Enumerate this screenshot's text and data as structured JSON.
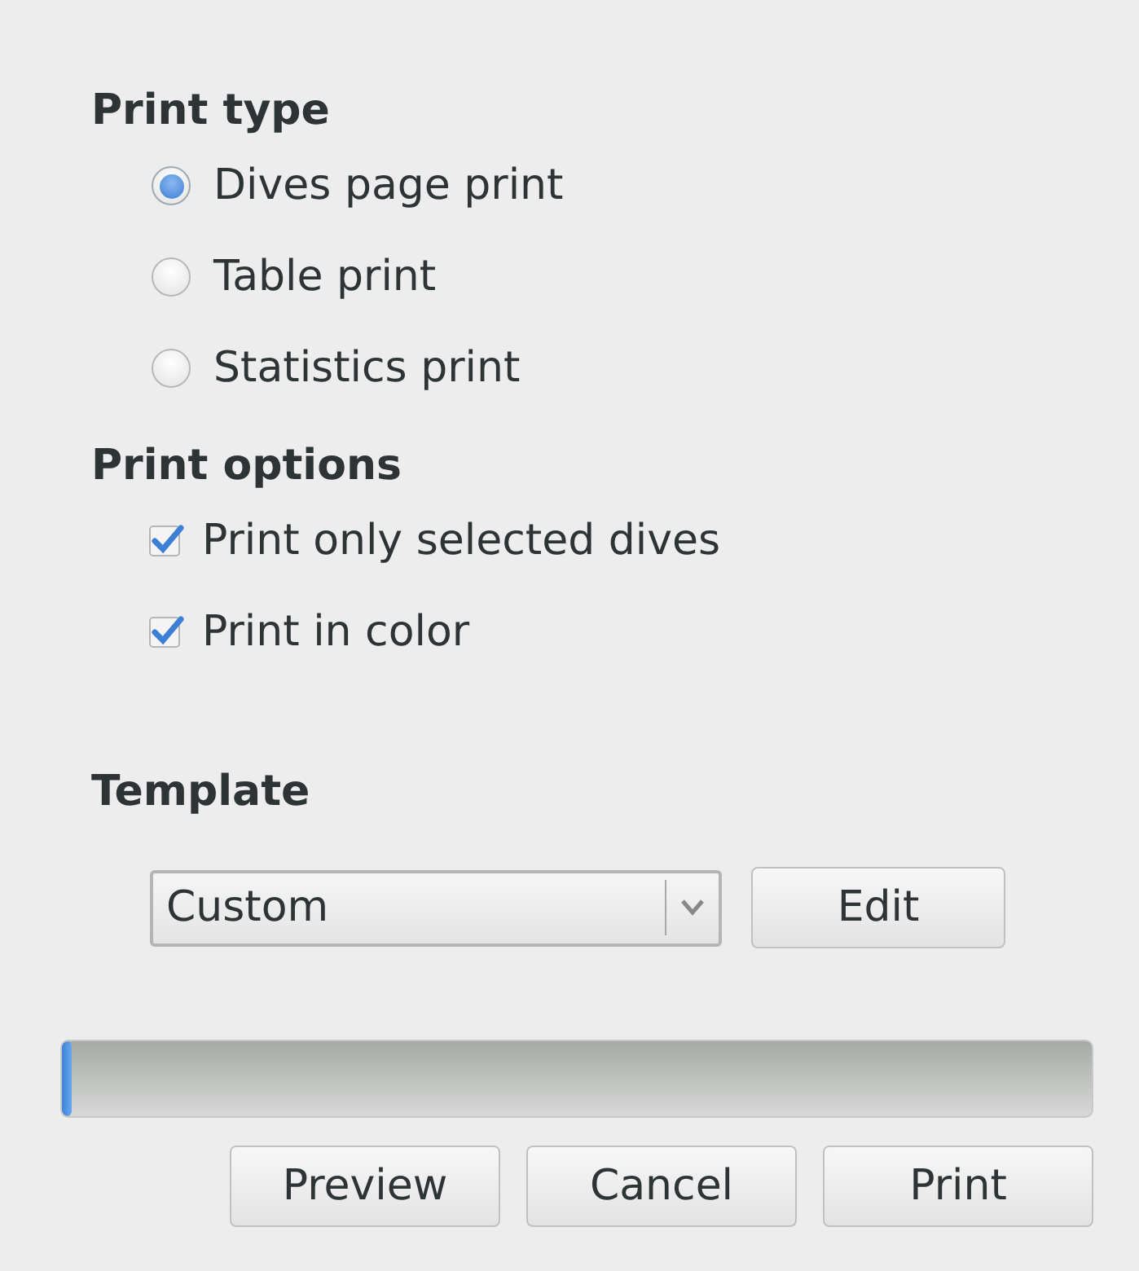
{
  "print_type": {
    "heading": "Print type",
    "options": [
      {
        "label": "Dives page print",
        "selected": true
      },
      {
        "label": "Table print",
        "selected": false
      },
      {
        "label": "Statistics print",
        "selected": false
      }
    ]
  },
  "print_options": {
    "heading": "Print options",
    "options": [
      {
        "label": "Print only selected dives",
        "checked": true
      },
      {
        "label": "Print in color",
        "checked": true
      }
    ]
  },
  "template": {
    "heading": "Template",
    "value": "Custom",
    "edit_button": "Edit"
  },
  "progress": {
    "level": 0.01
  },
  "buttons": [
    {
      "label": "Preview"
    },
    {
      "label": "Cancel"
    },
    {
      "label": "Print"
    }
  ]
}
